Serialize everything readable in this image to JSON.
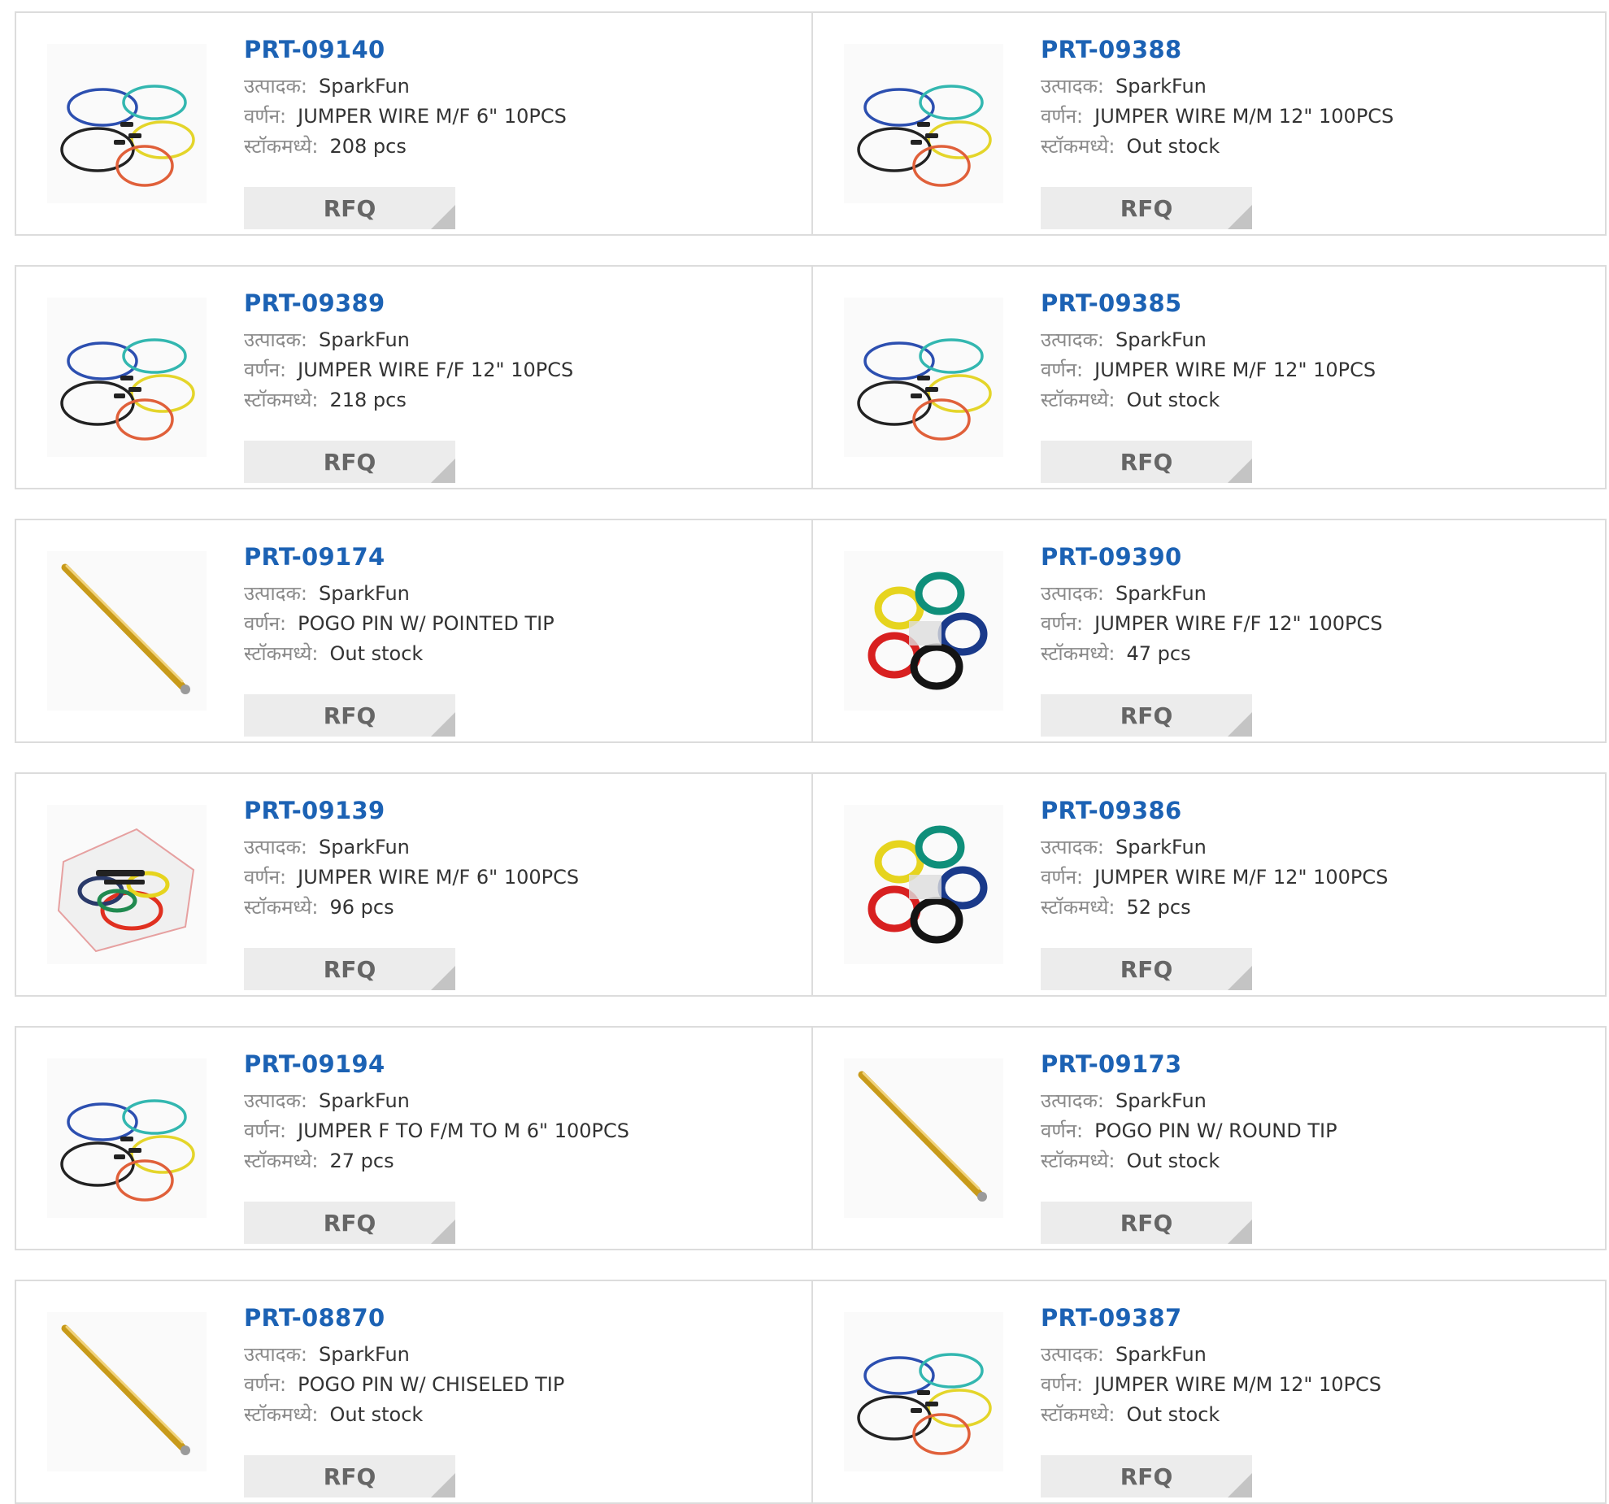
{
  "labels": {
    "manufacturer": "उत्पादक:",
    "description": "वर्णन:",
    "stock": "स्टॉकमध्ये:",
    "rfq": "RFQ"
  },
  "colors": {
    "part_link": "#1c62b4",
    "label": "#8a8a8a",
    "border": "#dcdcdc",
    "rfq_bg": "#ececec",
    "rfq_text": "#666666"
  },
  "products": [
    {
      "part": "PRT-09140",
      "manufacturer": "SparkFun",
      "description": "JUMPER WIRE M/F 6\" 10PCS",
      "stock": "208 pcs",
      "image": "jumper-wire-loops-icon"
    },
    {
      "part": "PRT-09388",
      "manufacturer": "SparkFun",
      "description": "JUMPER WIRE M/M 12\" 100PCS",
      "stock": "Out stock",
      "image": "jumper-wire-loops-icon"
    },
    {
      "part": "PRT-09389",
      "manufacturer": "SparkFun",
      "description": "JUMPER WIRE F/F 12\" 10PCS",
      "stock": "218 pcs",
      "image": "jumper-wire-loops-icon"
    },
    {
      "part": "PRT-09385",
      "manufacturer": "SparkFun",
      "description": "JUMPER WIRE M/F 12\" 10PCS",
      "stock": "Out stock",
      "image": "jumper-wire-loops-icon"
    },
    {
      "part": "PRT-09174",
      "manufacturer": "SparkFun",
      "description": "POGO PIN W/ POINTED TIP",
      "stock": "Out stock",
      "image": "pogo-pin-icon"
    },
    {
      "part": "PRT-09390",
      "manufacturer": "SparkFun",
      "description": "JUMPER WIRE F/F 12\" 100PCS",
      "stock": "47 pcs",
      "image": "jumper-wire-bundle-icon"
    },
    {
      "part": "PRT-09139",
      "manufacturer": "SparkFun",
      "description": "JUMPER WIRE M/F 6\" 100PCS",
      "stock": "96 pcs",
      "image": "jumper-wire-bag-icon"
    },
    {
      "part": "PRT-09386",
      "manufacturer": "SparkFun",
      "description": "JUMPER WIRE M/F 12\" 100PCS",
      "stock": "52 pcs",
      "image": "jumper-wire-bundle-icon"
    },
    {
      "part": "PRT-09194",
      "manufacturer": "SparkFun",
      "description": "JUMPER F TO F/M TO M 6\" 100PCS",
      "stock": "27 pcs",
      "image": "jumper-wire-loops-icon"
    },
    {
      "part": "PRT-09173",
      "manufacturer": "SparkFun",
      "description": "POGO PIN W/ ROUND TIP",
      "stock": "Out stock",
      "image": "pogo-pin-icon"
    },
    {
      "part": "PRT-08870",
      "manufacturer": "SparkFun",
      "description": "POGO PIN W/ CHISELED TIP",
      "stock": "Out stock",
      "image": "pogo-pin-icon"
    },
    {
      "part": "PRT-09387",
      "manufacturer": "SparkFun",
      "description": "JUMPER WIRE M/M 12\" 10PCS",
      "stock": "Out stock",
      "image": "jumper-wire-loops-icon"
    }
  ]
}
